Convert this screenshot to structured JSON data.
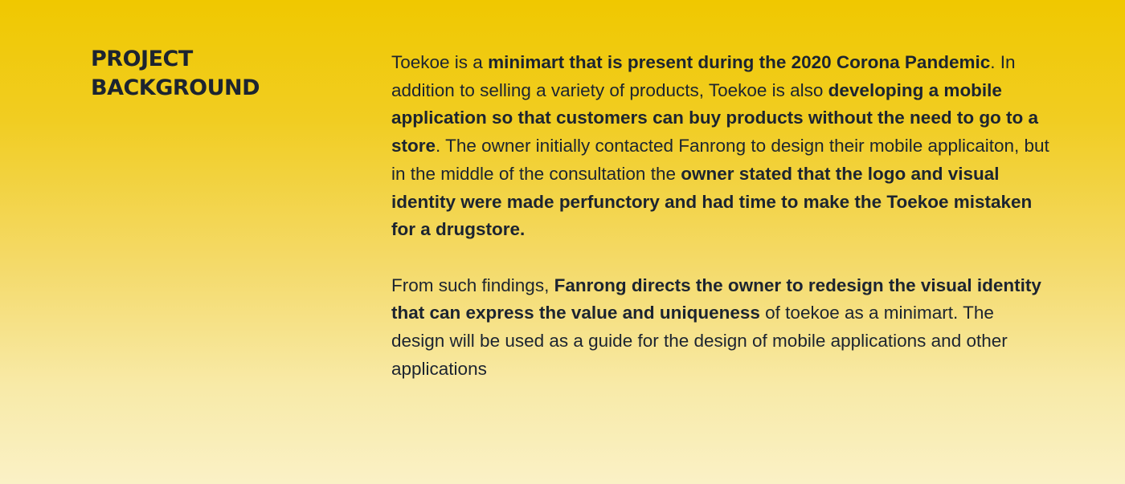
{
  "section": {
    "heading_line1": "PROJECT",
    "heading_line2": "BACKGROUND"
  },
  "paragraph1": {
    "s1": "Toekoe is a ",
    "s2": "minimart that is present during the 2020 Corona Pandemic",
    "s3": ". In addition to selling a variety of products, Toekoe is also ",
    "s4": "developing a mobile application so that customers can buy products without the need to go to a store",
    "s5": ". The owner initially contacted Fanrong to design their mobile applicaiton, but in the middle of the consultation the ",
    "s6": "owner stated that the logo and visual identity were made perfunctory and had time to make the Toekoe mistaken for a drugstore."
  },
  "paragraph2": {
    "s1": "From such findings, ",
    "s2": "Fanrong directs the owner to redesign the visual identity that can express the value and uniqueness",
    "s3": " of toekoe as a minimart. The design will be used as a guide for the design of mobile applications and other applications"
  }
}
